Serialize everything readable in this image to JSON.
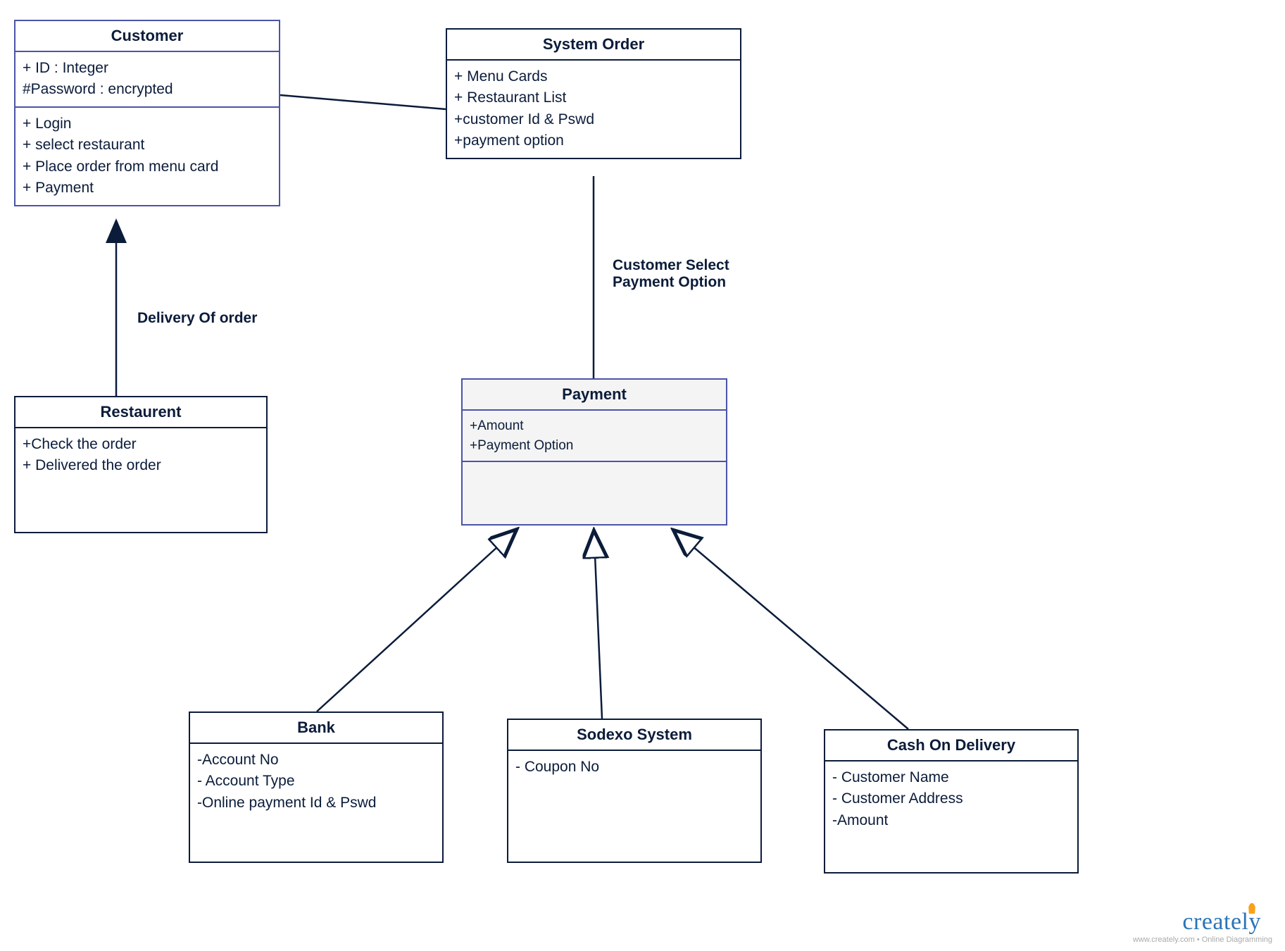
{
  "classes": {
    "customer": {
      "name": "Customer",
      "attributes": [
        "+ ID : Integer",
        "#Password : encrypted"
      ],
      "operations": [
        "+ Login",
        "+ select restaurant",
        "+  Place order from menu card",
        "+ Payment"
      ]
    },
    "systemOrder": {
      "name": "System Order",
      "attributes": [
        "+ Menu Cards",
        "+ Restaurant List",
        "+customer Id & Pswd",
        "+payment option"
      ]
    },
    "restaurent": {
      "name": "Restaurent",
      "operations": [
        "+Check the order",
        "+ Delivered the order"
      ]
    },
    "payment": {
      "name": "Payment",
      "attributes": [
        "+Amount",
        "+Payment Option"
      ]
    },
    "bank": {
      "name": "Bank",
      "attributes": [
        "-Account No",
        "- Account Type",
        "-Online payment Id & Pswd"
      ]
    },
    "sodexo": {
      "name": "Sodexo System",
      "attributes": [
        "- Coupon No"
      ]
    },
    "cod": {
      "name": "Cash On Delivery",
      "attributes": [
        "- Customer Name",
        "- Customer Address",
        "-Amount"
      ]
    }
  },
  "edges": {
    "deliveryOfOrder": "Delivery Of order",
    "selectPayment": "Customer Select\nPayment Option"
  },
  "branding": {
    "name": "creately",
    "tagline": "www.creately.com • Online Diagramming"
  }
}
